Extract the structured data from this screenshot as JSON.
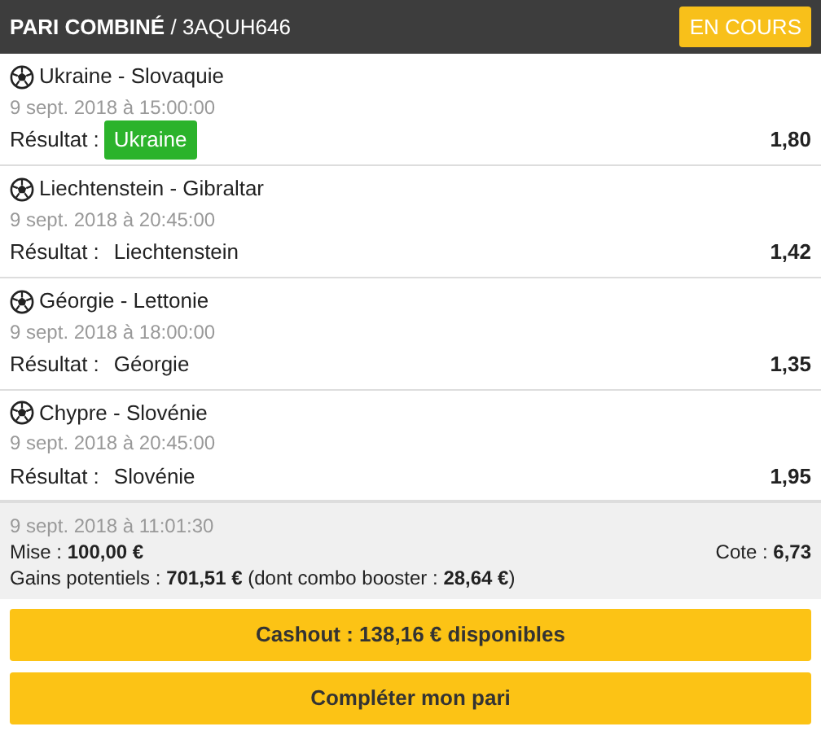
{
  "header": {
    "title": "**PARI COMBINÉ** / 3AQUH646",
    "status": "EN COURS"
  },
  "selections": [
    {
      "match": "Ukraine - Slovaquie",
      "date": "9 sept. 2018 à 15:00:00",
      "result_label": "Résultat :",
      "result": "Ukraine",
      "won": true,
      "odds": "1,80"
    },
    {
      "match": "Liechtenstein - Gibraltar",
      "date": "9 sept. 2018 à 20:45:00",
      "result_label": "Résultat :",
      "result": "Liechtenstein",
      "won": false,
      "odds": "1,42"
    },
    {
      "match": "Géorgie - Lettonie",
      "date": "9 sept. 2018 à 18:00:00",
      "result_label": "Résultat :",
      "result": "Géorgie",
      "won": false,
      "odds": "1,35"
    },
    {
      "match": "Chypre - Slovénie",
      "date": "9 sept. 2018 à 20:45:00",
      "result_label": "Résultat :",
      "result": "Slovénie",
      "won": false,
      "odds": "1,95"
    }
  ],
  "summary": {
    "placed": "9 sept. 2018 à 11:01:30",
    "stake": "Mise : **100,00 €**",
    "odds": "Cote : **6,73**",
    "potential": "Gains potentiels : **701,51 €** (dont combo booster : **28,64 €**)"
  },
  "buttons": [
    "Cashout : 138,16 € disponibles",
    "Compléter mon pari"
  ]
}
